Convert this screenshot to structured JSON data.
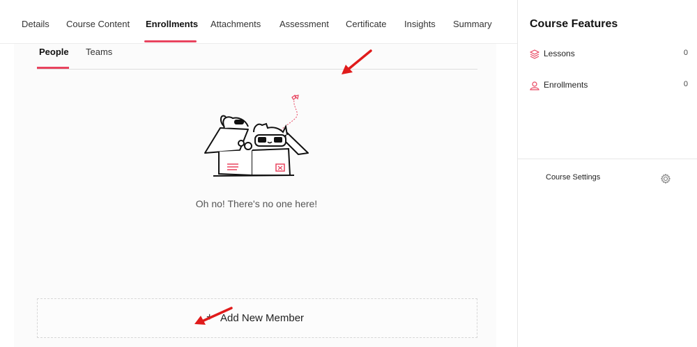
{
  "tabs": [
    {
      "label": "Details"
    },
    {
      "label": "Course Content"
    },
    {
      "label": "Enrollments",
      "active": true
    },
    {
      "label": "Attachments"
    },
    {
      "label": "Assessment"
    },
    {
      "label": "Certificate"
    },
    {
      "label": "Insights"
    },
    {
      "label": "Summary"
    }
  ],
  "subtabs": [
    {
      "label": "People",
      "active": true
    },
    {
      "label": "Teams"
    }
  ],
  "empty_state": {
    "message": "Oh no! There's no one here!"
  },
  "add_member": {
    "label": "Add New Member",
    "icon": "plus-icon"
  },
  "sidebar": {
    "title": "Course Features",
    "features": [
      {
        "label": "Lessons",
        "count": "0",
        "icon": "layers-icon"
      },
      {
        "label": "Enrollments",
        "count": "0",
        "icon": "users-icon"
      }
    ],
    "settings_label": "Course Settings",
    "settings_icon": "gear-icon"
  },
  "colors": {
    "accent": "#e8435e",
    "arrow": "#e01b1b"
  }
}
